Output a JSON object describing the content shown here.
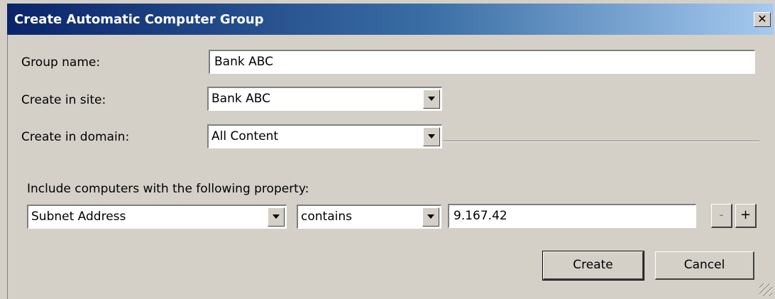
{
  "window": {
    "title": "Create Automatic Computer Group",
    "close_label": "✕"
  },
  "form": {
    "group_name_label": "Group name:",
    "group_name_value": "Bank ABC",
    "site_label": "Create in site:",
    "site_value": "Bank ABC",
    "domain_label": "Create in domain:",
    "domain_value": "All Content"
  },
  "criteria": {
    "heading": "Include computers with the following property:",
    "property_value": "Subnet Address",
    "operator_value": "contains",
    "match_value": "9.167.42",
    "remove_label": "-",
    "add_label": "+"
  },
  "buttons": {
    "create_label": "Create",
    "cancel_label": "Cancel"
  }
}
